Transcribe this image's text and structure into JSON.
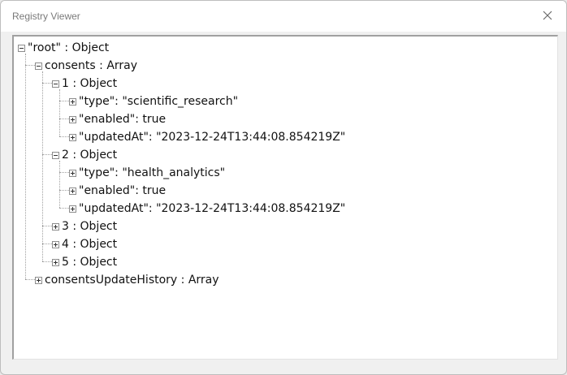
{
  "window": {
    "title": "Registry Viewer",
    "close_icon": "close-icon"
  },
  "tree": {
    "root": "\"root\" : Object",
    "consents": "consents : Array",
    "c1": "1 : Object",
    "c1_type": "\"type\": \"scientific_research\"",
    "c1_enabled": "\"enabled\": true",
    "c1_updated": "\"updatedAt\": \"2023-12-24T13:44:08.854219Z\"",
    "c2": "2 : Object",
    "c2_type": "\"type\": \"health_analytics\"",
    "c2_enabled": "\"enabled\": true",
    "c2_updated": "\"updatedAt\": \"2023-12-24T13:44:08.854219Z\"",
    "c3": "3 : Object",
    "c4": "4 : Object",
    "c5": "5 : Object",
    "history": "consentsUpdateHistory : Array"
  }
}
